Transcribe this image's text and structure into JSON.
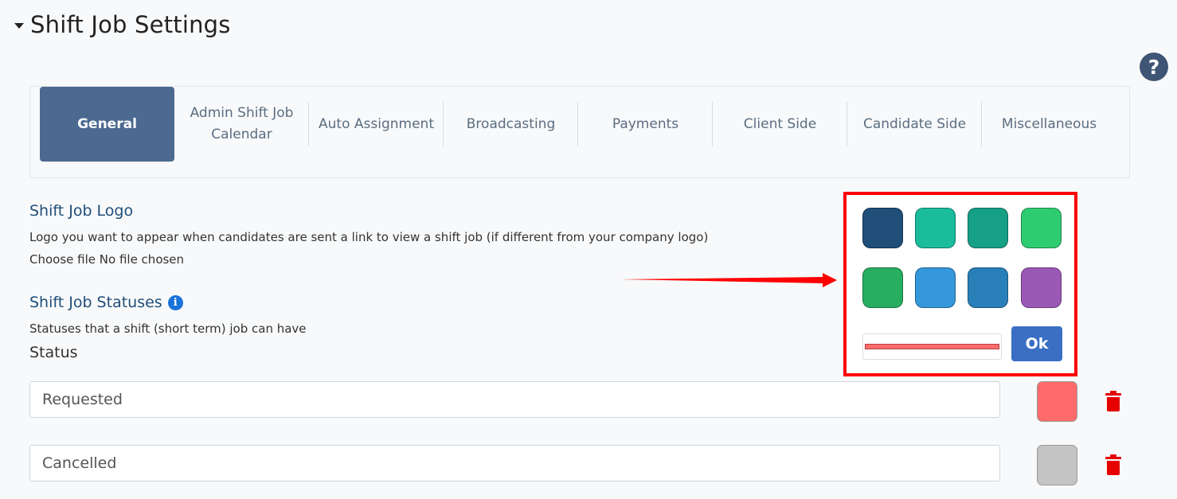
{
  "page": {
    "title": "Shift Job Settings",
    "help_icon": "question-circle-icon"
  },
  "tabs": [
    {
      "label": "General",
      "active": true
    },
    {
      "label": "Admin Shift Job\nCalendar",
      "active": false
    },
    {
      "label": "Auto Assignment",
      "active": false
    },
    {
      "label": "Broadcasting",
      "active": false
    },
    {
      "label": "Payments",
      "active": false
    },
    {
      "label": "Client Side",
      "active": false
    },
    {
      "label": "Candidate Side",
      "active": false
    },
    {
      "label": "Miscellaneous",
      "active": false
    }
  ],
  "logo_section": {
    "title": "Shift Job Logo",
    "description": "Logo you want to appear when candidates are sent a link to view a shift job (if different from your company logo)",
    "file_button": "Choose file",
    "file_status": "No file chosen"
  },
  "statuses_section": {
    "title": "Shift Job Statuses",
    "info_icon": "info-circle-icon",
    "description": "Statuses that a shift (short term) job can have",
    "column_label": "Status",
    "rows": [
      {
        "value": "Requested",
        "color": "#ff6b6b"
      },
      {
        "value": "Cancelled",
        "color": "#c4c4c4"
      }
    ]
  },
  "color_picker": {
    "swatches": [
      "#1f4e79",
      "#1abc9c",
      "#16a085",
      "#2ecc71",
      "#27ae60",
      "#3498db",
      "#2980b9",
      "#9b59b6"
    ],
    "current_color": "#ff6b6b",
    "ok_label": "Ok",
    "highlight_color": "#ff0000"
  }
}
